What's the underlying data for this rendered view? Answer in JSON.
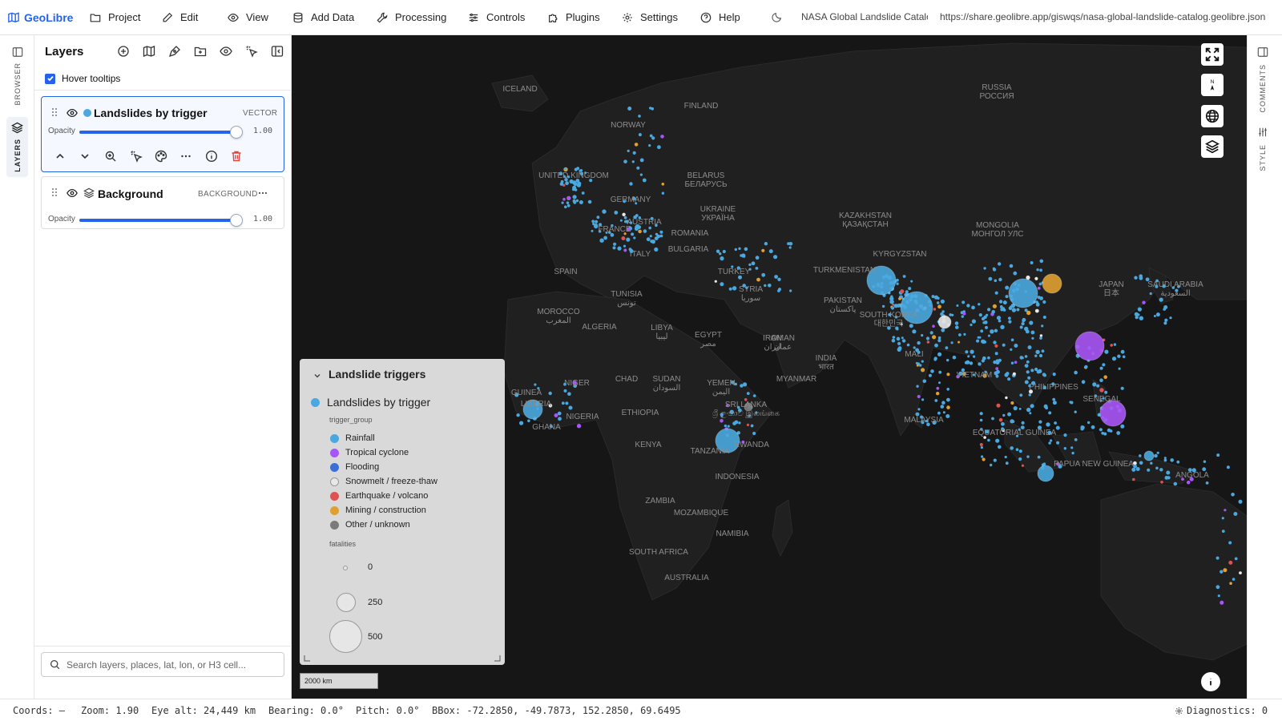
{
  "app": {
    "brand": "GeoLibre",
    "project_title": "NASA Global Landslide Catalog",
    "project_url": "https://share.geolibre.app/giswqs/nasa-global-landslide-catalog.geolibre.json"
  },
  "menu": [
    {
      "label": "Project",
      "icon": "folder-icon"
    },
    {
      "label": "Edit",
      "icon": "pencil-icon"
    },
    {
      "label": "View",
      "icon": "eye-icon"
    },
    {
      "label": "Add Data",
      "icon": "database-icon"
    },
    {
      "label": "Processing",
      "icon": "wrench-icon"
    },
    {
      "label": "Controls",
      "icon": "sliders-icon"
    },
    {
      "label": "Plugins",
      "icon": "puzzle-icon"
    },
    {
      "label": "Settings",
      "icon": "gear-icon"
    },
    {
      "label": "Help",
      "icon": "help-circle-icon"
    }
  ],
  "left_rail": {
    "browser": "BROWSER",
    "layers": "LAYERS"
  },
  "right_rail": {
    "comments": "COMMENTS",
    "style": "STYLE"
  },
  "layers_panel": {
    "title": "Layers",
    "hover_tooltips_label": "Hover tooltips",
    "hover_tooltips_checked": true,
    "search_placeholder": "Search layers, places, lat, lon, or H3 cell...",
    "layers": [
      {
        "name": "Landslides by trigger",
        "type": "VECTOR",
        "opacity_label": "Opacity",
        "opacity": "1.00",
        "color": "#4aa8e0"
      },
      {
        "name": "Background",
        "type": "BACKGROUND",
        "opacity_label": "Opacity",
        "opacity": "1.00"
      }
    ]
  },
  "legend": {
    "title": "Landslide triggers",
    "layer_name": "Landslides by trigger",
    "category_field": "trigger_group",
    "categories": [
      {
        "label": "Rainfall",
        "color": "#4aa8e0"
      },
      {
        "label": "Tropical cyclone",
        "color": "#a855f7"
      },
      {
        "label": "Flooding",
        "color": "#3b6fd6"
      },
      {
        "label": "Snowmelt / freeze-thaw",
        "color": "#e8e8e8"
      },
      {
        "label": "Earthquake / volcano",
        "color": "#e05252"
      },
      {
        "label": "Mining / construction",
        "color": "#e0a030"
      },
      {
        "label": "Other / unknown",
        "color": "#7a7a7a"
      }
    ],
    "size_field": "fatalities",
    "sizes": [
      "0",
      "250",
      "500"
    ]
  },
  "map": {
    "scale": "2000 km",
    "labels": [
      {
        "text": "ICELAND"
      },
      {
        "text": "FINLAND"
      },
      {
        "text": "NORWAY"
      },
      {
        "text": "RUSSIA\nРОССИЯ"
      },
      {
        "text": "UNITED KINGDOM"
      },
      {
        "text": "BELARUS\nБЕЛАРУСЬ"
      },
      {
        "text": "GERMANY"
      },
      {
        "text": "UKRAINE\nУКРАЇНА"
      },
      {
        "text": "FRANCE"
      },
      {
        "text": "AUSTRIA"
      },
      {
        "text": "ROMANIA"
      },
      {
        "text": "BULGARIA"
      },
      {
        "text": "ITALY"
      },
      {
        "text": "SPAIN"
      },
      {
        "text": "TURKEY"
      },
      {
        "text": "KAZAKHSTAN\nҚАЗАҚСТАН"
      },
      {
        "text": "MONGOLIA\nМОНГОЛ УЛС"
      },
      {
        "text": "KYRGYZSTAN"
      },
      {
        "text": "TURKMENISTAN"
      },
      {
        "text": "SYRIA\nسوريا"
      },
      {
        "text": "TUNISIA\nتونس"
      },
      {
        "text": "MOROCCO\nالمغرب"
      },
      {
        "text": "ALGERIA"
      },
      {
        "text": "LIBYA\nليبيا"
      },
      {
        "text": "EGYPT\nمصر"
      },
      {
        "text": "IRAN\nایران"
      },
      {
        "text": "PAKISTAN\nپاکستان"
      },
      {
        "text": "SOUTH KOREA\n대한민국"
      },
      {
        "text": "JAPAN\n日本"
      },
      {
        "text": "SAUDI ARABIA\nالسعودية"
      },
      {
        "text": "OMAN\nعمان"
      },
      {
        "text": "INDIA\nभारत"
      },
      {
        "text": "MALI"
      },
      {
        "text": "NIGER"
      },
      {
        "text": "CHAD"
      },
      {
        "text": "SUDAN\nالسودان"
      },
      {
        "text": "YEMEN\nاليمن"
      },
      {
        "text": "MYANMAR"
      },
      {
        "text": "VIETNAM"
      },
      {
        "text": "PHILIPPINES"
      },
      {
        "text": "SENEGAL"
      },
      {
        "text": "GUINEA"
      },
      {
        "text": "LIBERIA"
      },
      {
        "text": "GHANA"
      },
      {
        "text": "NIGERIA"
      },
      {
        "text": "ETHIOPIA"
      },
      {
        "text": "SRI LANKA\nශ්‍රී ලංකාව இலங்கை"
      },
      {
        "text": "MALAYSIA"
      },
      {
        "text": "EQUATORIAL GUINEA"
      },
      {
        "text": "KENYA"
      },
      {
        "text": "RWANDA"
      },
      {
        "text": "TANZANIA"
      },
      {
        "text": "INDONESIA"
      },
      {
        "text": "PAPUA NEW GUINEA"
      },
      {
        "text": "ANGOLA"
      },
      {
        "text": "ZAMBIA"
      },
      {
        "text": "MOZAMBIQUE"
      },
      {
        "text": "NAMIBIA"
      },
      {
        "text": "SOUTH AFRICA"
      },
      {
        "text": "AUSTRALIA"
      }
    ]
  },
  "status": {
    "coords": "Coords: —",
    "zoom": "Zoom: 1.90",
    "eye_alt": "Eye alt: 24,449 km",
    "bearing": "Bearing: 0.0°",
    "pitch": "Pitch: 0.0°",
    "bbox": "BBox: -72.2850, -49.7873, 152.2850, 69.6495",
    "diagnostics": "Diagnostics: 0"
  }
}
